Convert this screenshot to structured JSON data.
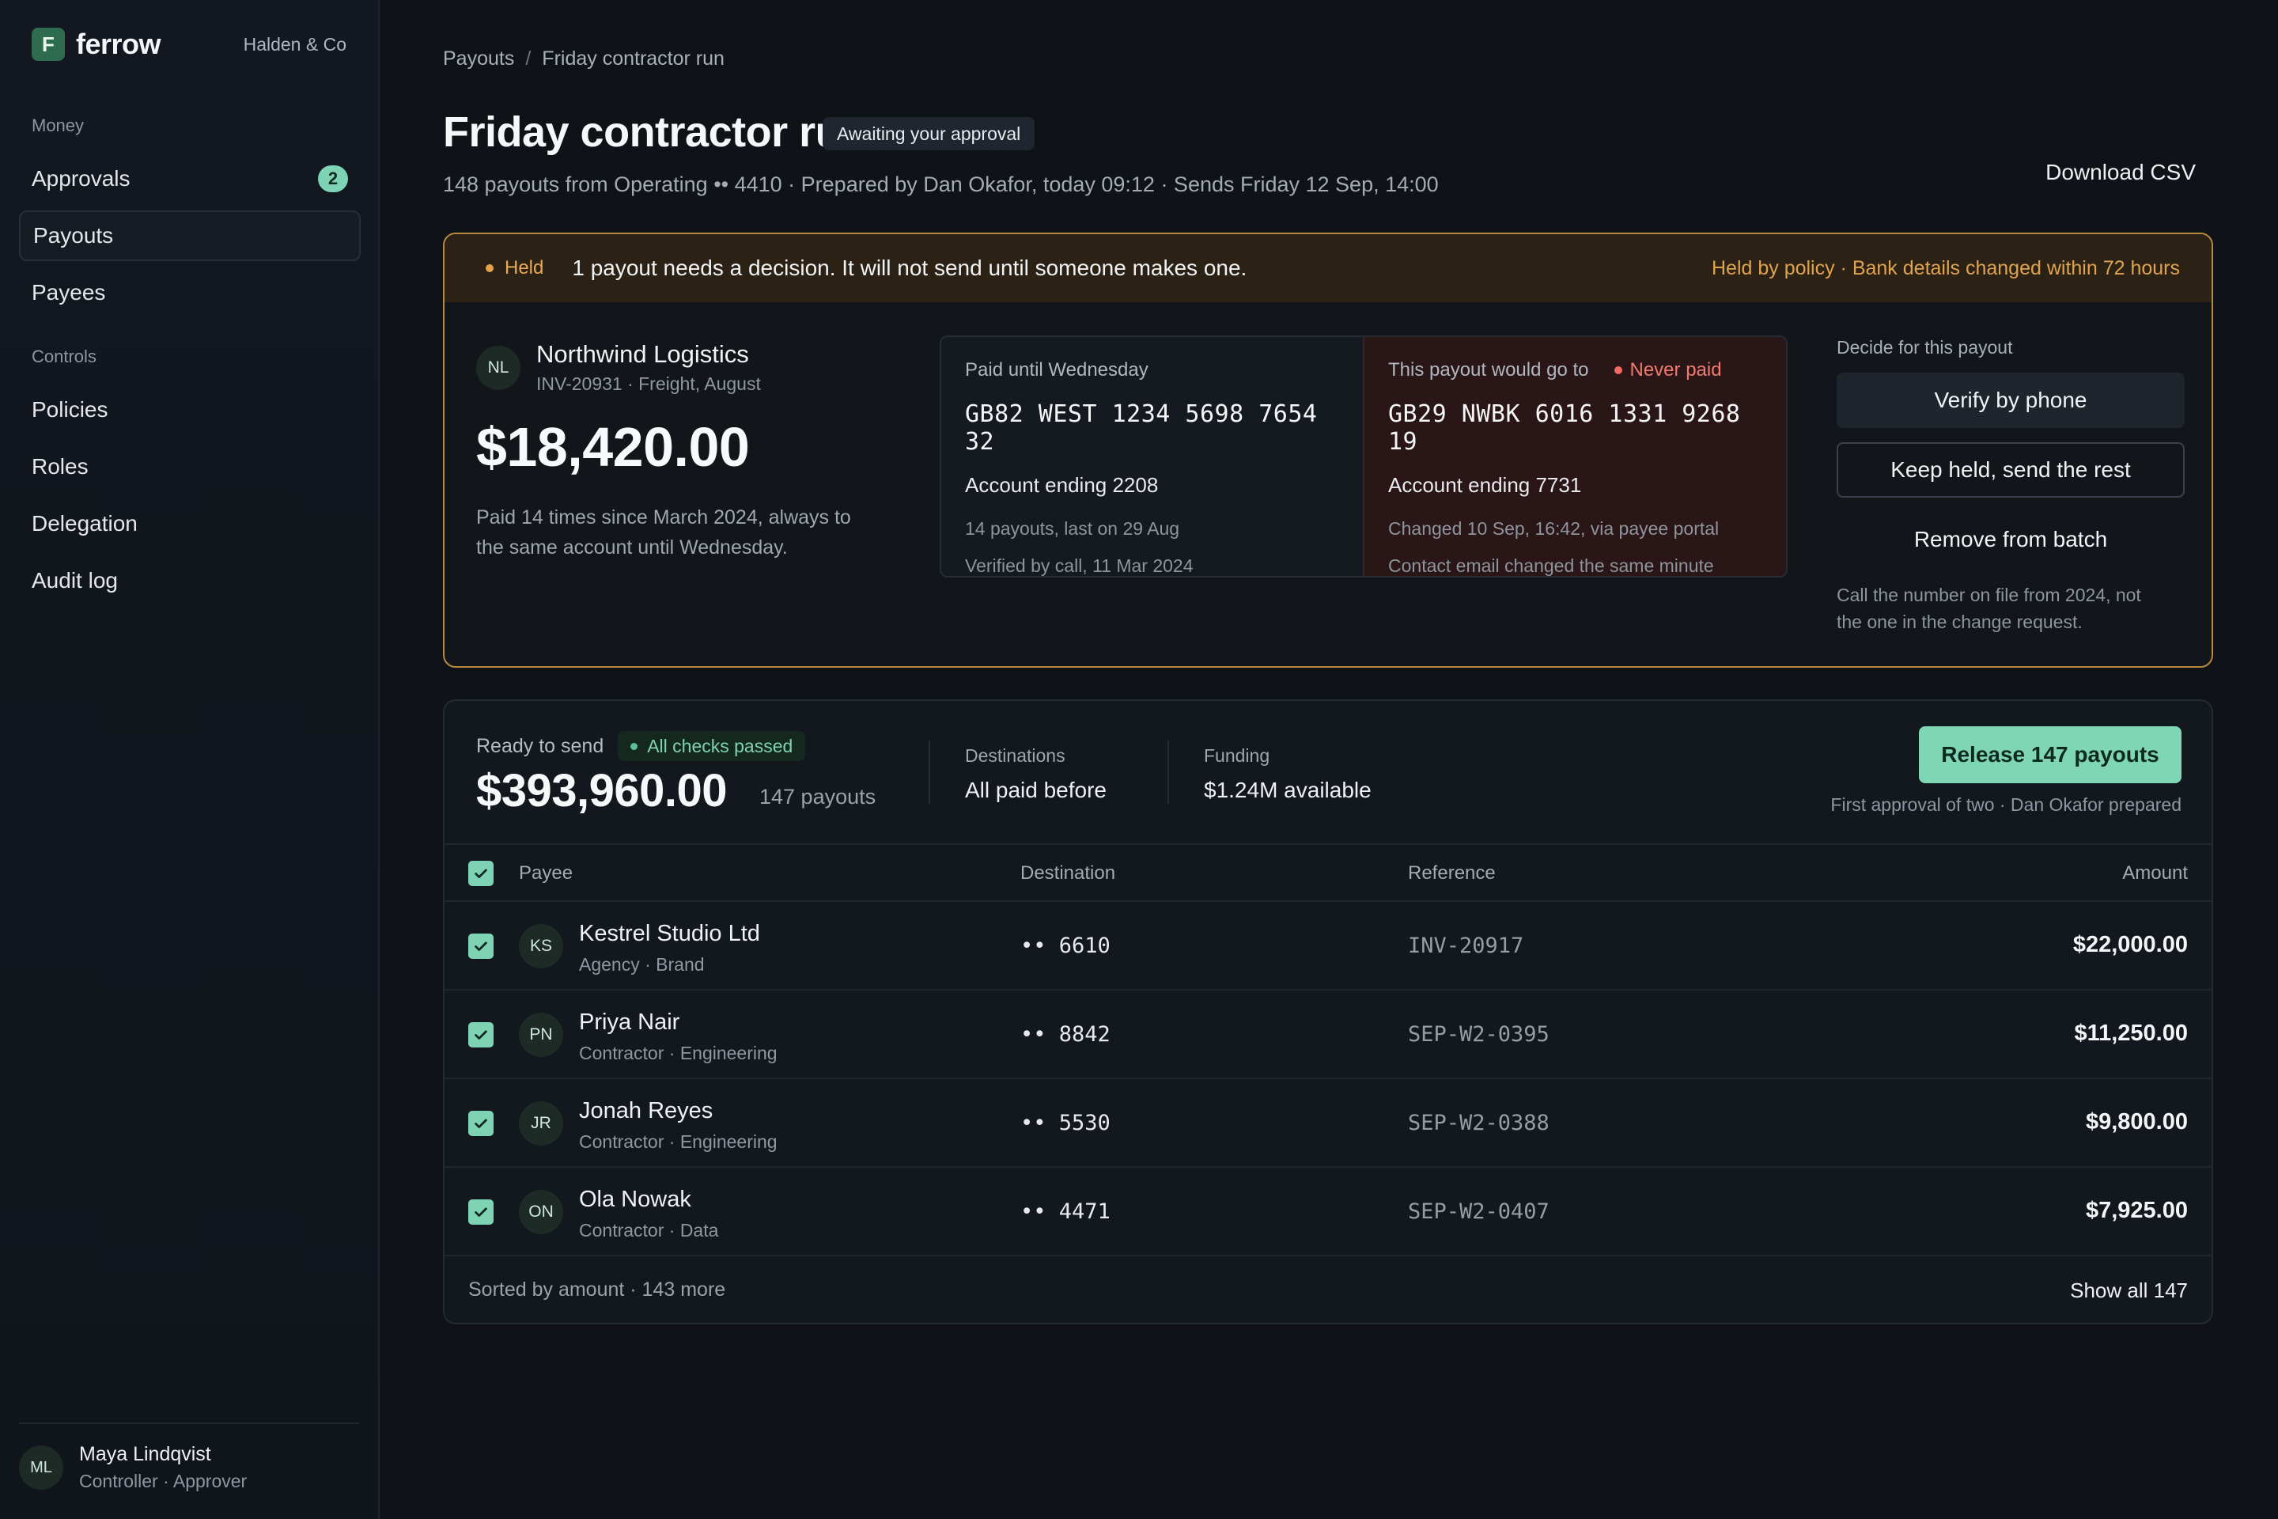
{
  "brand": {
    "name": "ferrow",
    "org": "Halden & Co"
  },
  "sidebar": {
    "section_money": "Money",
    "section_controls": "Controls",
    "items": [
      {
        "label": "Approvals",
        "badge": "2"
      },
      {
        "label": "Payouts"
      },
      {
        "label": "Payees"
      },
      {
        "label": "Policies"
      },
      {
        "label": "Roles"
      },
      {
        "label": "Delegation"
      },
      {
        "label": "Audit log"
      }
    ],
    "user": {
      "initials": "ML",
      "name": "Maya Lindqvist",
      "role": "Controller · Approver"
    }
  },
  "header": {
    "breadcrumb": [
      "Payouts",
      "/",
      "Friday contractor run"
    ],
    "title": "Friday contractor run",
    "status": "Awaiting your approval",
    "subtitle": "148 payouts from Operating •• 4410 · Prepared by Dan Okafor, today 09:12 · Sends Friday 12 Sep, 14:00",
    "download": "Download CSV"
  },
  "held": {
    "tag": "Held",
    "message": "1 payout needs a decision. It will not send until someone makes one.",
    "reason": "Held by policy · Bank details changed within 72 hours",
    "payee": {
      "initials": "NL",
      "name": "Northwind Logistics",
      "sub": "INV-20931 · Freight, August",
      "amount": "$18,420.00",
      "note_1": "Paid 14 times since March 2024, always to",
      "note_2": "the same account until Wednesday."
    },
    "old": {
      "label": "Paid until Wednesday",
      "iban": "GB82 WEST 1234 5698 7654 32",
      "account": "Account ending 2208",
      "meta_1": "14 payouts, last on 29 Aug",
      "meta_2": "Verified by call, 11 Mar 2024"
    },
    "new": {
      "label": "This payout would go to",
      "flag": "Never paid",
      "iban": "GB29 NWBK 6016 1331 9268 19",
      "account": "Account ending 7731",
      "meta_1": "Changed 10 Sep, 16:42, via payee portal",
      "meta_2": "Contact email changed the same minute"
    },
    "decide": {
      "label": "Decide for this payout",
      "verify": "Verify by phone",
      "keep": "Keep held, send the rest",
      "remove": "Remove from batch",
      "note_1": "Call the number on file from 2024, not",
      "note_2": "the one in the change request."
    }
  },
  "ready": {
    "label": "Ready to send",
    "checks": "All checks passed",
    "amount": "$393,960.00",
    "count": "147 payouts",
    "destinations_label": "Destinations",
    "destinations_value": "All paid before",
    "funding_label": "Funding",
    "funding_value": "$1.24M available",
    "release": "Release 147 payouts",
    "release_note": "First approval of two · Dan Okafor prepared"
  },
  "table": {
    "headers": {
      "payee": "Payee",
      "destination": "Destination",
      "reference": "Reference",
      "amount": "Amount"
    },
    "rows": [
      {
        "initials": "KS",
        "name": "Kestrel Studio Ltd",
        "sub": "Agency · Brand",
        "dest": "•• 6610",
        "ref": "INV-20917",
        "amount": "$22,000.00"
      },
      {
        "initials": "PN",
        "name": "Priya Nair",
        "sub": "Contractor · Engineering",
        "dest": "•• 8842",
        "ref": "SEP-W2-0395",
        "amount": "$11,250.00"
      },
      {
        "initials": "JR",
        "name": "Jonah Reyes",
        "sub": "Contractor · Engineering",
        "dest": "•• 5530",
        "ref": "SEP-W2-0388",
        "amount": "$9,800.00"
      },
      {
        "initials": "ON",
        "name": "Ola Nowak",
        "sub": "Contractor · Data",
        "dest": "•• 4471",
        "ref": "SEP-W2-0407",
        "amount": "$7,925.00"
      }
    ],
    "footer_left": "Sorted by amount · 143 more",
    "footer_right": "Show all 147"
  }
}
